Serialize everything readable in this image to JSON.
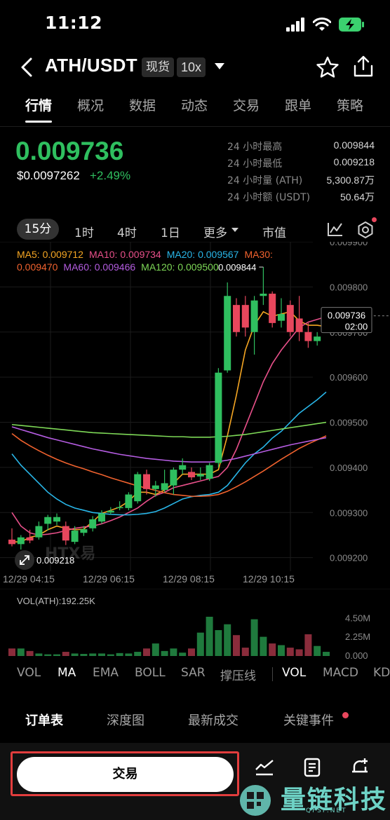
{
  "status": {
    "time": "11:12"
  },
  "header": {
    "pair": "ATH/USDT",
    "market": "现货",
    "leverage": "10x"
  },
  "tabs": [
    "行情",
    "概况",
    "数据",
    "动态",
    "交易",
    "跟单",
    "策略"
  ],
  "price": {
    "last": "0.009736",
    "usd": "$0.0097262",
    "change": "+2.49%",
    "stats": [
      {
        "label": "24 小时最高",
        "value": "0.009844"
      },
      {
        "label": "24 小时最低",
        "value": "0.009218"
      },
      {
        "label": "24 小时量 (ATH)",
        "value": "5,300.87万"
      },
      {
        "label": "24 小时额 (USDT)",
        "value": "50.64万"
      }
    ]
  },
  "intervals": {
    "active": "15分",
    "items": [
      "1时",
      "4时",
      "1日",
      "更多",
      "市值"
    ]
  },
  "ma_legend": {
    "ma5": "MA5: 0.009712",
    "ma10": "MA10: 0.009734",
    "ma20": "MA20: 0.009567",
    "ma30": "MA30: 0.009470",
    "ma60": "MA60: 0.009466",
    "ma120": "MA120: 0.009500"
  },
  "chart_data": {
    "type": "candlestick",
    "interval": "15分",
    "y_ticks": [
      "0.009900",
      "0.009800",
      "0.009700",
      "0.009600",
      "0.009500",
      "0.009400",
      "0.009300",
      "0.009200"
    ],
    "ylim": [
      0.00917,
      0.0099
    ],
    "x_labels": [
      "12/29 04:15",
      "12/29 06:15",
      "12/29 08:15",
      "12/29 10:15"
    ],
    "high_label": "0.009844",
    "low_label": "0.009218",
    "current_label": {
      "price": "0.009736",
      "countdown": "02:00"
    },
    "candles": [
      {
        "o": 0.00924,
        "h": 0.009265,
        "l": 0.009225,
        "c": 0.00923
      },
      {
        "o": 0.00923,
        "h": 0.00925,
        "l": 0.009218,
        "c": 0.009245
      },
      {
        "o": 0.009245,
        "h": 0.009262,
        "l": 0.009232,
        "c": 0.009238
      },
      {
        "o": 0.009245,
        "h": 0.00928,
        "l": 0.00924,
        "c": 0.00927
      },
      {
        "o": 0.009275,
        "h": 0.009295,
        "l": 0.00926,
        "c": 0.00929
      },
      {
        "o": 0.00928,
        "h": 0.009298,
        "l": 0.009272,
        "c": 0.00929
      },
      {
        "o": 0.00927,
        "h": 0.00928,
        "l": 0.009228,
        "c": 0.009238
      },
      {
        "o": 0.009235,
        "h": 0.00927,
        "l": 0.00923,
        "c": 0.00926
      },
      {
        "o": 0.009255,
        "h": 0.00927,
        "l": 0.009248,
        "c": 0.009263
      },
      {
        "o": 0.009265,
        "h": 0.009292,
        "l": 0.009258,
        "c": 0.009285
      },
      {
        "o": 0.00928,
        "h": 0.009305,
        "l": 0.009275,
        "c": 0.009298
      },
      {
        "o": 0.0093,
        "h": 0.009312,
        "l": 0.009296,
        "c": 0.009304
      },
      {
        "o": 0.00931,
        "h": 0.009325,
        "l": 0.009305,
        "c": 0.009312
      },
      {
        "o": 0.00931,
        "h": 0.009345,
        "l": 0.009305,
        "c": 0.00934
      },
      {
        "o": 0.009325,
        "h": 0.00939,
        "l": 0.00932,
        "c": 0.009385
      },
      {
        "o": 0.009385,
        "h": 0.009395,
        "l": 0.00934,
        "c": 0.009352
      },
      {
        "o": 0.009352,
        "h": 0.00937,
        "l": 0.009335,
        "c": 0.00936
      },
      {
        "o": 0.00935,
        "h": 0.009395,
        "l": 0.009345,
        "c": 0.009365
      },
      {
        "o": 0.00936,
        "h": 0.0094,
        "l": 0.00934,
        "c": 0.009395
      },
      {
        "o": 0.009395,
        "h": 0.00942,
        "l": 0.009385,
        "c": 0.009405
      },
      {
        "o": 0.00939,
        "h": 0.0094,
        "l": 0.009372,
        "c": 0.009378
      },
      {
        "o": 0.00938,
        "h": 0.0094,
        "l": 0.009372,
        "c": 0.009385
      },
      {
        "o": 0.009375,
        "h": 0.00941,
        "l": 0.00937,
        "c": 0.009405
      },
      {
        "o": 0.00941,
        "h": 0.00962,
        "l": 0.0094,
        "c": 0.00961
      },
      {
        "o": 0.009615,
        "h": 0.00981,
        "l": 0.00961,
        "c": 0.00978
      },
      {
        "o": 0.00976,
        "h": 0.009775,
        "l": 0.00969,
        "c": 0.0097
      },
      {
        "o": 0.00976,
        "h": 0.00978,
        "l": 0.00969,
        "c": 0.00971
      },
      {
        "o": 0.0097,
        "h": 0.00978,
        "l": 0.00965,
        "c": 0.00977
      },
      {
        "o": 0.00978,
        "h": 0.009844,
        "l": 0.00976,
        "c": 0.009785
      },
      {
        "o": 0.009785,
        "h": 0.00979,
        "l": 0.00971,
        "c": 0.00972
      },
      {
        "o": 0.009725,
        "h": 0.009775,
        "l": 0.00971,
        "c": 0.00974
      },
      {
        "o": 0.00976,
        "h": 0.00977,
        "l": 0.00969,
        "c": 0.0097
      },
      {
        "o": 0.00973,
        "h": 0.00978,
        "l": 0.00968,
        "c": 0.0097
      },
      {
        "o": 0.0097,
        "h": 0.00972,
        "l": 0.009665,
        "c": 0.00968
      },
      {
        "o": 0.00968,
        "h": 0.0097,
        "l": 0.00967,
        "c": 0.00969
      },
      {
        "o": 0.009715,
        "h": 0.009745,
        "l": 0.00971,
        "c": 0.00974
      }
    ],
    "ma_series": [
      {
        "name": "MA5",
        "color": "#f5a623",
        "values": [
          0.009235,
          0.009235,
          0.009245,
          0.00925,
          0.009262,
          0.00927,
          0.009265,
          0.009262,
          0.009263,
          0.00928,
          0.009298,
          0.009305,
          0.009312,
          0.009325,
          0.009345,
          0.009345,
          0.00934,
          0.00935,
          0.009365,
          0.009385,
          0.009385,
          0.009385,
          0.009385,
          0.009395,
          0.00947,
          0.00956,
          0.00966,
          0.009715,
          0.009745,
          0.009735,
          0.00974,
          0.009745,
          0.009725,
          0.009715,
          0.009715,
          0.009712
        ]
      },
      {
        "name": "MA10",
        "color": "#e8508a",
        "values": [
          0.0093,
          0.00927,
          0.009255,
          0.00925,
          0.009252,
          0.009255,
          0.00926,
          0.009265,
          0.009268,
          0.00927,
          0.009275,
          0.009282,
          0.00929,
          0.0093,
          0.00931,
          0.009325,
          0.009338,
          0.009345,
          0.009355,
          0.00936,
          0.009365,
          0.00937,
          0.009375,
          0.00938,
          0.0094,
          0.00944,
          0.00949,
          0.00954,
          0.00959,
          0.00963,
          0.00966,
          0.009685,
          0.00971,
          0.009722,
          0.009728,
          0.009734
        ]
      },
      {
        "name": "MA20",
        "color": "#29b6e8",
        "values": [
          0.00943,
          0.009405,
          0.009385,
          0.009365,
          0.009345,
          0.00933,
          0.009318,
          0.00931,
          0.009305,
          0.0093,
          0.009298,
          0.009296,
          0.009295,
          0.009295,
          0.009296,
          0.009298,
          0.009302,
          0.00931,
          0.00932,
          0.00933,
          0.009335,
          0.009338,
          0.00934,
          0.009345,
          0.00936,
          0.009385,
          0.00941,
          0.00943,
          0.009445,
          0.009465,
          0.00948,
          0.0095,
          0.00952,
          0.009535,
          0.00955,
          0.009567
        ]
      },
      {
        "name": "MA30",
        "color": "#f0622e",
        "values": [
          0.009475,
          0.00946,
          0.009448,
          0.009437,
          0.009427,
          0.009418,
          0.00941,
          0.009403,
          0.009397,
          0.00939,
          0.009384,
          0.009377,
          0.009371,
          0.009365,
          0.009359,
          0.009354,
          0.009349,
          0.009344,
          0.00934,
          0.009338,
          0.009336,
          0.009336,
          0.009337,
          0.00934,
          0.009347,
          0.009357,
          0.009368,
          0.00938,
          0.009392,
          0.009405,
          0.009418,
          0.00943,
          0.009442,
          0.009452,
          0.009461,
          0.00947
        ]
      },
      {
        "name": "MA60",
        "color": "#b45ce0",
        "values": [
          0.00949,
          0.009484,
          0.009478,
          0.009472,
          0.009466,
          0.009461,
          0.009456,
          0.009451,
          0.009446,
          0.009441,
          0.009437,
          0.009433,
          0.009429,
          0.009426,
          0.009423,
          0.00942,
          0.009418,
          0.009416,
          0.009414,
          0.009413,
          0.009412,
          0.009412,
          0.009412,
          0.009413,
          0.009416,
          0.00942,
          0.009425,
          0.00943,
          0.009435,
          0.00944,
          0.009445,
          0.00945,
          0.009454,
          0.009458,
          0.009462,
          0.009466
        ]
      },
      {
        "name": "MA120",
        "color": "#7ed957",
        "values": [
          0.009495,
          0.009493,
          0.009491,
          0.009489,
          0.009487,
          0.009485,
          0.009483,
          0.009481,
          0.009479,
          0.009477,
          0.009476,
          0.009475,
          0.009474,
          0.009473,
          0.009472,
          0.009471,
          0.00947,
          0.009469,
          0.009468,
          0.009468,
          0.009467,
          0.009467,
          0.009467,
          0.009468,
          0.009469,
          0.009471,
          0.009473,
          0.009476,
          0.009479,
          0.009482,
          0.009485,
          0.009488,
          0.009491,
          0.009494,
          0.009497,
          0.0095
        ]
      }
    ],
    "volume": {
      "label": "VOL(ATH):192.25K",
      "y_ticks": [
        "4.50M",
        "2.25M",
        "0.000"
      ],
      "ylim": [
        0,
        4700000
      ],
      "values": [
        900000,
        900000,
        600000,
        300000,
        200000,
        200000,
        500000,
        300000,
        250000,
        300000,
        300000,
        200000,
        350000,
        300000,
        500000,
        900000,
        1500000,
        600000,
        900000,
        400000,
        900000,
        2800000,
        4700000,
        3100000,
        3800000,
        2500000,
        1000000,
        4400000,
        2300000,
        1500000,
        1300000,
        1000000,
        800000,
        2600000,
        1200000,
        500000
      ]
    }
  },
  "indicators": {
    "main": [
      "VOL",
      "MA",
      "EMA",
      "BOLL",
      "SAR",
      "撑压线"
    ],
    "sub": [
      "VOL",
      "MACD",
      "KD"
    ],
    "active_main": "MA",
    "active_sub": "VOL"
  },
  "bottom_tabs": [
    "订单表",
    "深度图",
    "最新成交",
    "关键事件"
  ],
  "trade_button": "交易",
  "watermark": "量链科技",
  "watermark_sub": "QFSP.NET",
  "chart_watermark": "HTX易",
  "colors": {
    "up": "#2fbf5f",
    "down": "#e8475d",
    "accent": "#e23d3d"
  }
}
